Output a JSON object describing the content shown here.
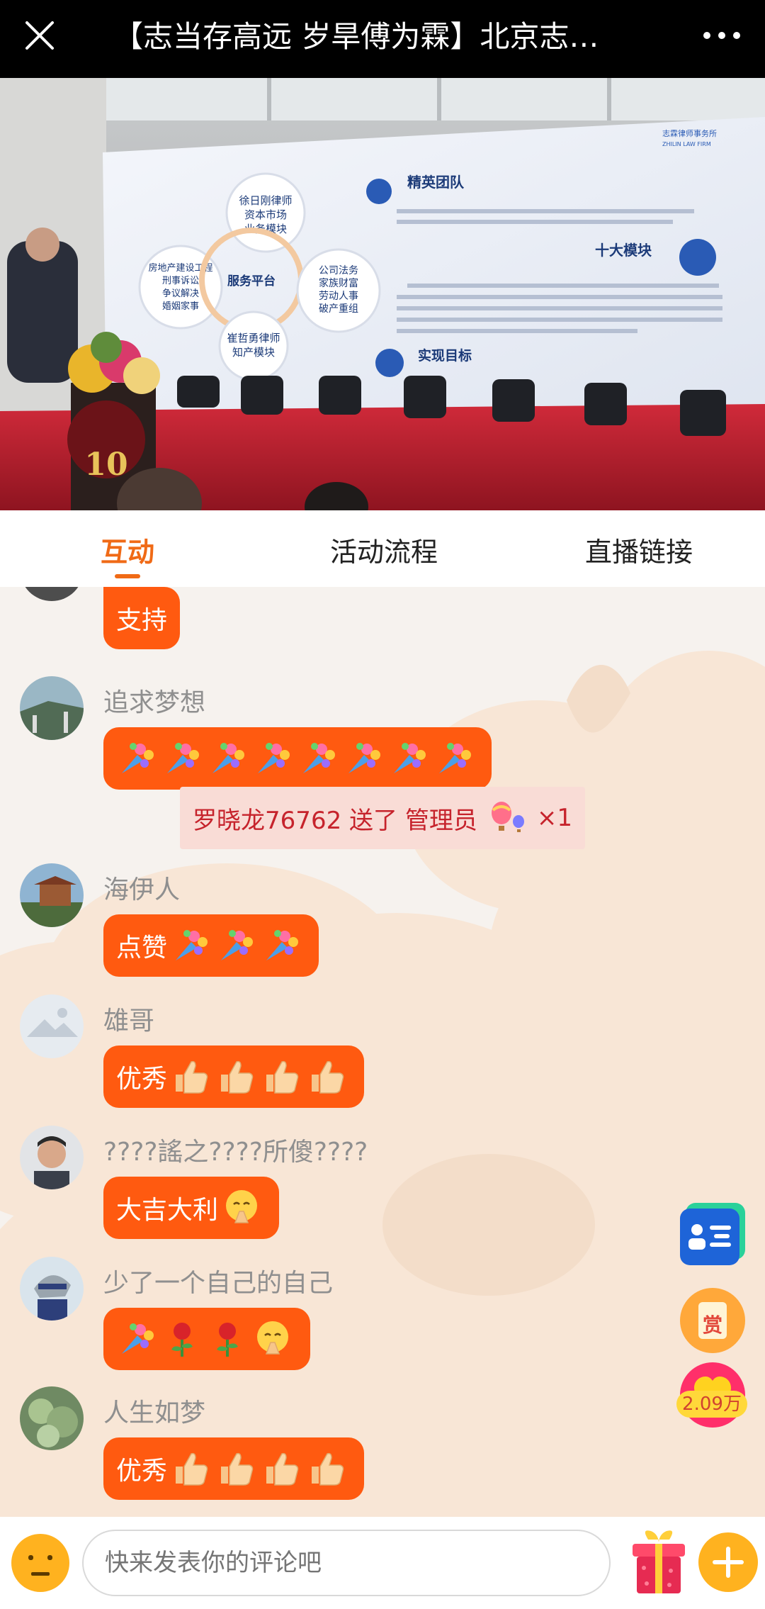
{
  "header": {
    "title": "【志当存高远 岁旱傅为霖】北京志…"
  },
  "stage": {
    "left_panel": [
      "徐日刚律师",
      "资本市场",
      "业务模块"
    ],
    "center_label": "服务平台",
    "left_lower": [
      "房地产建设工程",
      "刑事诉讼",
      "争议解决",
      "婚姻家事"
    ],
    "right_panel": [
      "公司法务",
      "家族财富",
      "劳动人事",
      "破产重组"
    ],
    "bottom_panel": [
      "崔哲勇律师",
      "知产模块"
    ],
    "section1": "精英团队",
    "section1_text": "以谢阳律师为代表的一大批心怀理想、眼中有光芒的精英律师汇聚于志霖，标志着志霖已经进入综合性一流律所的行列；",
    "section2": "十大模块",
    "section2_text": "在律所管委会的领导下形成十大业务模块，以崔哲勇律师主管的知产业务模块和徐日刚律师领导的资本市场业务模块为龙头，房地产建设工程、刑事诉讼、争议解决、婚姻家事、公司法务、劳动人事、破产重组业务和家族财富全面发展的业务格局；",
    "section3": "实现目标",
    "section3_text": "目前，已经…过百，收入…步目标。",
    "logo_text": "志霖律师事务所",
    "logo_sub": "ZHILIN LAW FIRM",
    "podium_number": "10"
  },
  "tabs": [
    {
      "label": "互动",
      "active": true
    },
    {
      "label": "活动流程",
      "active": false
    },
    {
      "label": "直播链接",
      "active": false
    }
  ],
  "messages": [
    {
      "user": "",
      "text": "支持",
      "emojis": []
    },
    {
      "user": "追求梦想",
      "text": "",
      "emojis": [
        "bouquet",
        "bouquet",
        "bouquet",
        "bouquet",
        "bouquet",
        "bouquet",
        "bouquet",
        "bouquet"
      ]
    },
    {
      "user": "海伊人",
      "text": "点赞",
      "emojis": [
        "bouquet",
        "bouquet",
        "bouquet"
      ]
    },
    {
      "user": "雄哥",
      "text": "优秀",
      "emojis": [
        "thumbs-up",
        "thumbs-up",
        "thumbs-up",
        "thumbs-up"
      ]
    },
    {
      "user": "????謠之????所傻????",
      "text": "大吉大利",
      "emojis": [
        "pray"
      ]
    },
    {
      "user": "少了一个自己的自己",
      "text": "",
      "emojis": [
        "bouquet",
        "rose",
        "rose",
        "pray"
      ]
    },
    {
      "user": "人生如梦",
      "text": "优秀",
      "emojis": [
        "thumbs-up",
        "thumbs-up",
        "thumbs-up",
        "thumbs-up"
      ]
    }
  ],
  "gift_notice": {
    "text": "罗晓龙76762 送了 管理员",
    "count": "×1"
  },
  "side": {
    "reward_label": "赏",
    "likes": "2.09万"
  },
  "bottom": {
    "placeholder": "快来发表你的评论吧"
  },
  "colors": {
    "accent": "#f06a16",
    "bubble": "#ff5a10",
    "gift_text": "#c6232c"
  }
}
